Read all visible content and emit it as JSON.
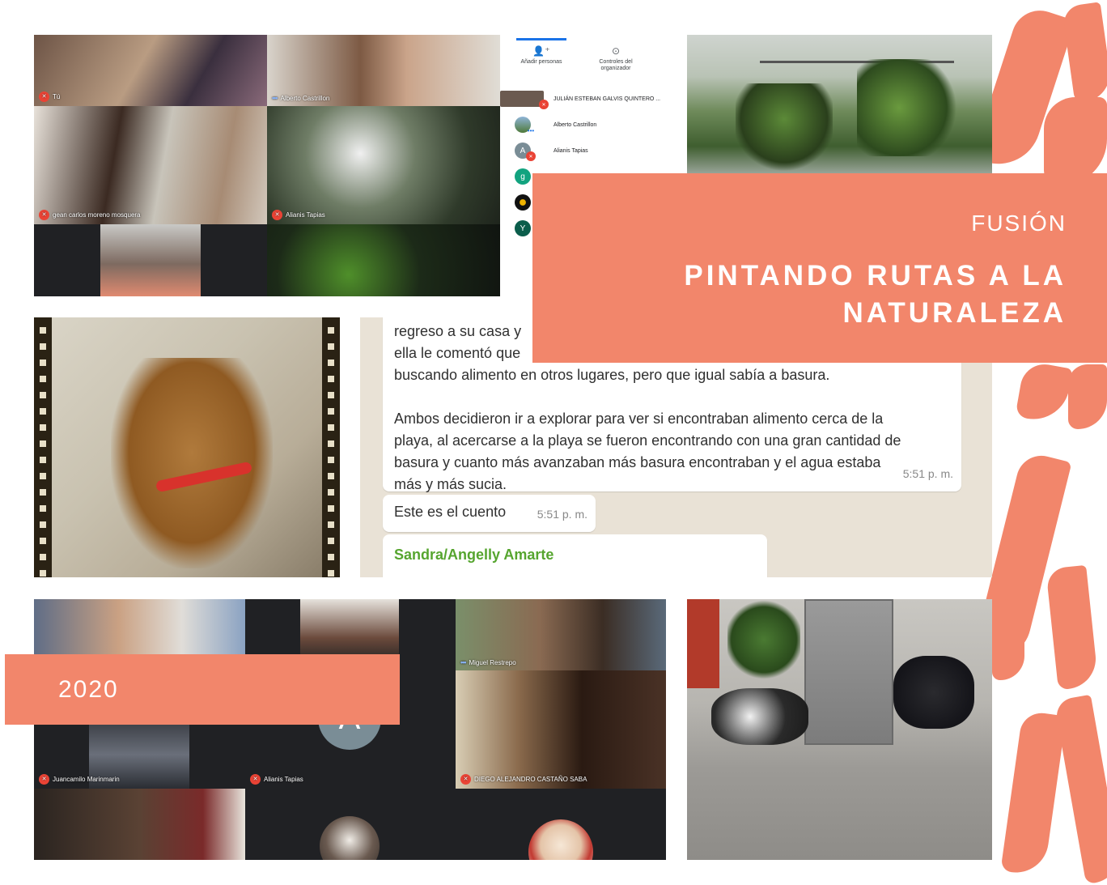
{
  "title": {
    "kicker": "FUSIÓN",
    "main": "PINTANDO RUTAS A LA NATURALEZA"
  },
  "year_label": "2020",
  "call_top": {
    "tiles": [
      {
        "name": "Tú",
        "muted": true
      },
      {
        "name": "Alberto Castrillon",
        "muted": false
      },
      {
        "name": "gean carlos moreno mosquera",
        "muted": true
      },
      {
        "name": "Alianis Tapias",
        "muted": true
      }
    ]
  },
  "participants_panel": {
    "add_label": "Añadir personas",
    "controls_label": "Controles del organizador",
    "people": [
      {
        "name": "JULIÁN ESTEBAN GALVIS QUINTERO ...",
        "initial": ""
      },
      {
        "name": "Alberto Castrillon",
        "initial": ""
      },
      {
        "name": "Alianis Tapias",
        "initial": "A"
      },
      {
        "name": "",
        "initial": "g"
      },
      {
        "name": "",
        "initial": ""
      },
      {
        "name": "",
        "initial": "Y"
      }
    ]
  },
  "chat": {
    "message_lines": [
      "regreso a su casa y",
      "ella le comentó que",
      "buscando alimento en otros lugares, pero que igual sabía a basura.",
      "",
      "Ambos decidieron ir a explorar para ver si encontraban alimento cerca de la",
      "playa, al acercarse a la playa se fueron encontrando con una gran cantidad de",
      "basura y cuanto más avanzaban más basura encontraban y el agua estaba",
      "más y más sucia."
    ],
    "message_time": "5:51 p. m.",
    "short_message": "Este es el cuento",
    "short_time": "5:51 p. m.",
    "sender": "Sandra/Angelly Amarte"
  },
  "call_bottom": {
    "tiles": [
      {
        "name": "Miguel Restrepo",
        "muted": false
      },
      {
        "name": "Juancamilo Marinmarin",
        "muted": true
      },
      {
        "name": "Alianis Tapias",
        "muted": true
      },
      {
        "name": "DIEGO ALEJANDRO CASTAÑO SABA",
        "muted": true
      }
    ],
    "avatar_initial": "A"
  },
  "colors": {
    "accent": "#f2866b",
    "mute_red": "#ea4335",
    "sender_green": "#56a52f"
  }
}
